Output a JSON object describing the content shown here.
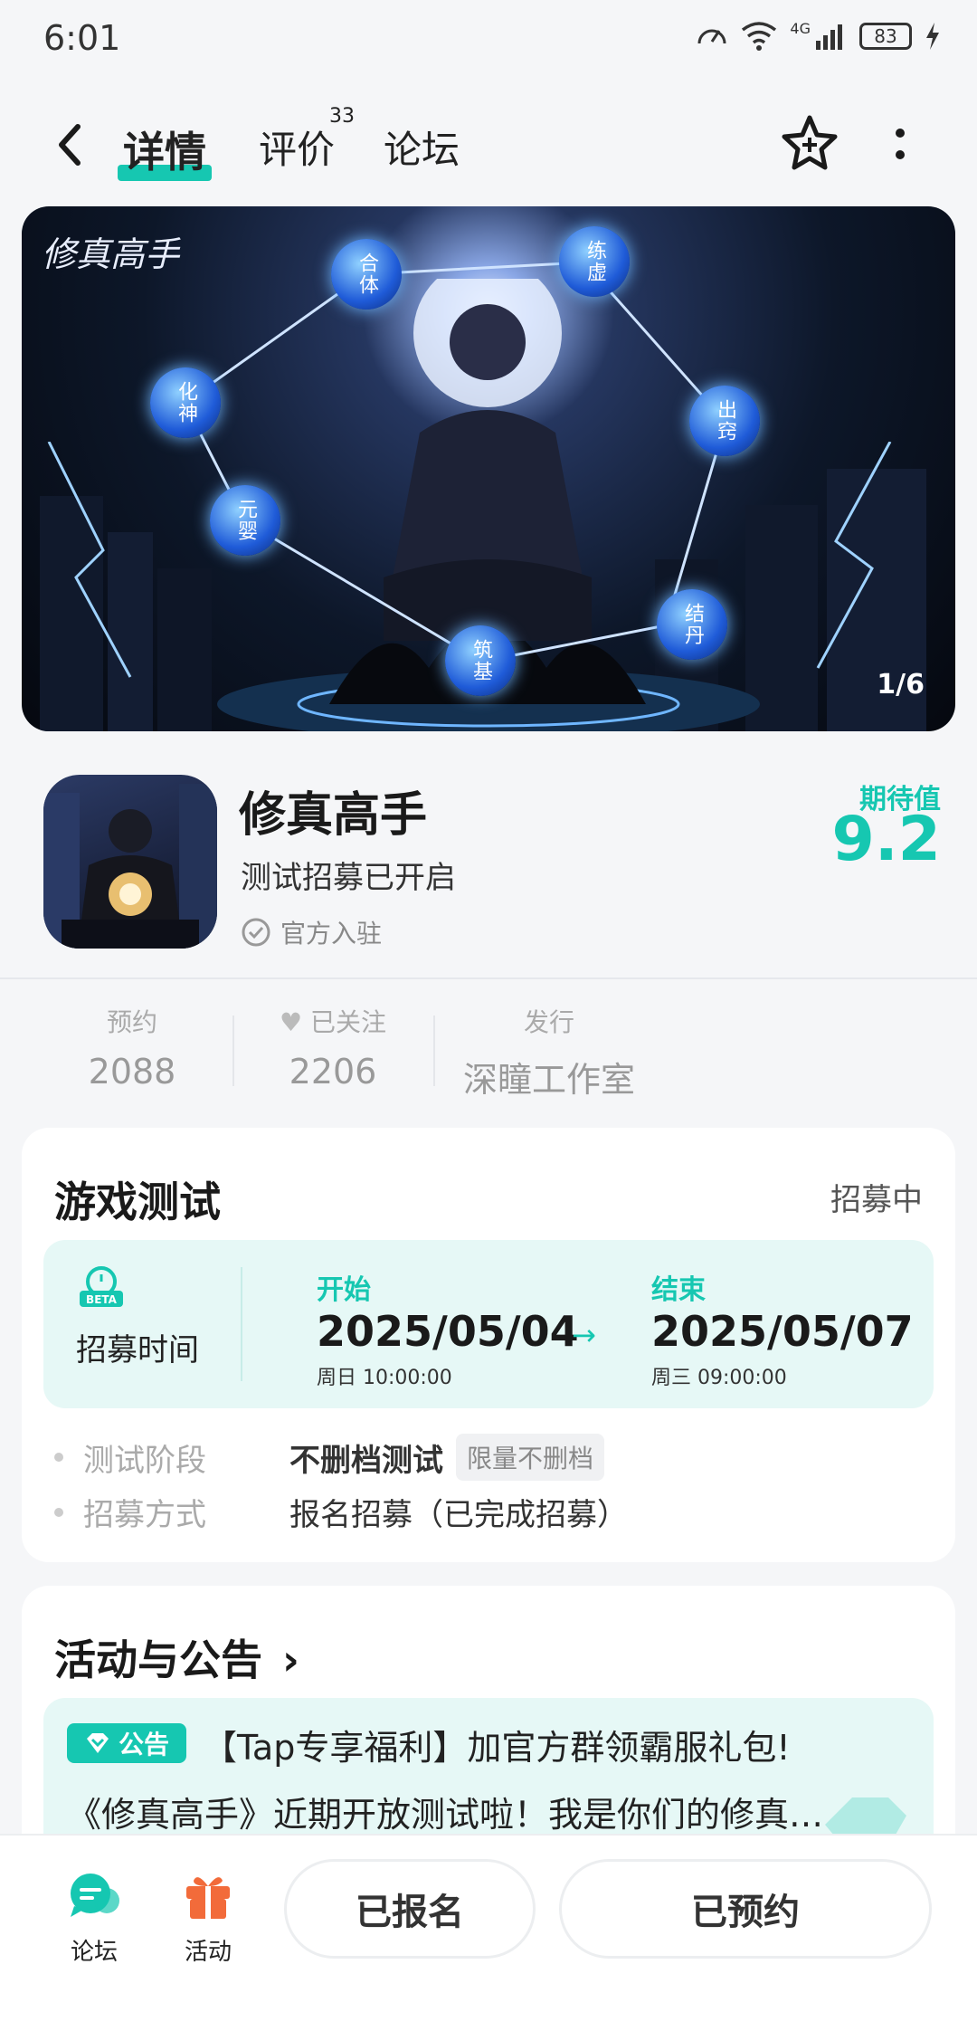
{
  "status_bar": {
    "time": "6:01",
    "network": "4G",
    "battery": "83"
  },
  "nav": {
    "tabs": [
      {
        "label": "详情"
      },
      {
        "label": "评价",
        "badge": "33"
      },
      {
        "label": "论坛"
      }
    ]
  },
  "banner": {
    "logo_text": "修真高手",
    "counter": "1/6",
    "orbs": [
      "合体",
      "练虚",
      "化神",
      "出窍",
      "元婴",
      "结丹",
      "筑基"
    ]
  },
  "game": {
    "title": "修真高手",
    "subtitle": "测试招募已开启",
    "official": "官方入驻",
    "expect_label": "期待值",
    "expect_value": "9.2"
  },
  "stats": {
    "reserve_label": "预约",
    "reserve_value": "2088",
    "follow_label": "已关注",
    "follow_value": "2206",
    "publisher_label": "发行",
    "publisher_value": "深瞳工作室"
  },
  "test_card": {
    "title": "游戏测试",
    "status": "招募中",
    "beta": "BETA",
    "recruit_time_label": "招募时间",
    "start_label": "开始",
    "start_date": "2025/05/04",
    "start_sub": "周日  10:00:00",
    "end_label": "结束",
    "end_date": "2025/05/07",
    "end_sub": "周三  09:00:00",
    "arrow": "→",
    "stage_label": "测试阶段",
    "stage_value": "不删档测试",
    "stage_tag": "限量不删档",
    "method_label": "招募方式",
    "method_value": "报名招募（已完成招募）"
  },
  "activity_card": {
    "title": "活动与公告",
    "chevron": "›",
    "notice_badge": "公告",
    "notice_line1": "【Tap专享福利】加官方群领霸服礼包!",
    "notice_line2": "《修真高手》近期开放测试啦！我是你们的修真…"
  },
  "bottom_bar": {
    "forum_label": "论坛",
    "activity_label": "活动",
    "signed_up_label": "已报名",
    "reserved_label": "已预约"
  },
  "colors": {
    "accent": "#16c7b1",
    "activity_icon": "#f26b3a"
  }
}
